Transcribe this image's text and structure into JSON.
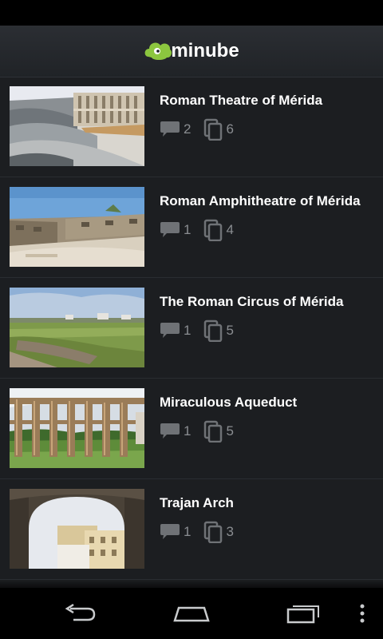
{
  "app": {
    "logo_text": "minube",
    "brand_color": "#8cc63f"
  },
  "places": [
    {
      "title": "Roman Theatre of Mérida",
      "comments": "2",
      "photos": "6"
    },
    {
      "title": "Roman Amphitheatre of Mérida",
      "comments": "1",
      "photos": "4"
    },
    {
      "title": "The Roman Circus of Mérida",
      "comments": "1",
      "photos": "5"
    },
    {
      "title": "Miraculous Aqueduct",
      "comments": "1",
      "photos": "5"
    },
    {
      "title": "Trajan Arch",
      "comments": "1",
      "photos": "3"
    }
  ],
  "icons": {
    "comment": "speech-bubble-icon",
    "photos": "photo-stack-icon",
    "back": "back-icon",
    "home": "home-icon",
    "recents": "recent-apps-icon",
    "menu": "overflow-menu-icon"
  }
}
